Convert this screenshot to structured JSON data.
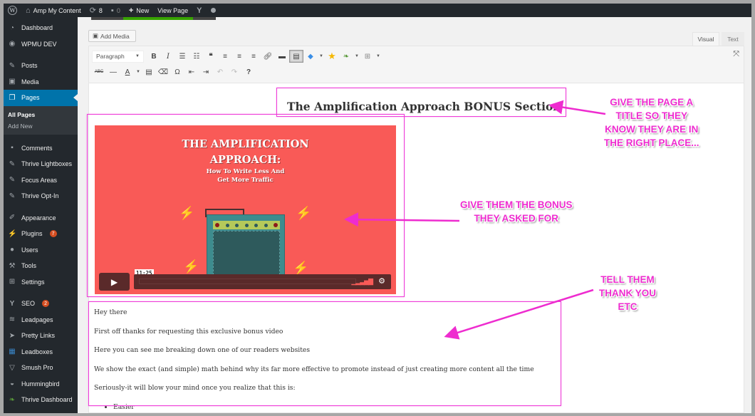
{
  "admin_bar": {
    "site_name": "Amp My Content",
    "updates_count": "8",
    "comments_count": "0",
    "new_label": "New",
    "view_page_label": "View Page",
    "progress": 0.75
  },
  "sidebar": {
    "items": [
      {
        "label": "Dashboard",
        "icon": "dashboard-icon"
      },
      {
        "label": "WPMU DEV",
        "icon": "wpmudev-icon"
      },
      {
        "label": "Posts",
        "icon": "pin-icon"
      },
      {
        "label": "Media",
        "icon": "media-icon"
      },
      {
        "label": "Pages",
        "icon": "pages-icon",
        "active": true
      },
      {
        "label": "Comments",
        "icon": "comment-icon"
      },
      {
        "label": "Thrive Lightboxes",
        "icon": "pin-icon"
      },
      {
        "label": "Focus Areas",
        "icon": "pin-icon"
      },
      {
        "label": "Thrive Opt-In",
        "icon": "pin-icon"
      },
      {
        "label": "Appearance",
        "icon": "brush-icon"
      },
      {
        "label": "Plugins",
        "icon": "plugin-icon",
        "badge": "7"
      },
      {
        "label": "Users",
        "icon": "user-icon"
      },
      {
        "label": "Tools",
        "icon": "wrench-icon"
      },
      {
        "label": "Settings",
        "icon": "settings-icon"
      },
      {
        "label": "SEO",
        "icon": "yoast-icon",
        "badge": "2"
      },
      {
        "label": "Leadpages",
        "icon": "layers-icon"
      },
      {
        "label": "Pretty Links",
        "icon": "star-arrow-icon"
      },
      {
        "label": "Leadboxes",
        "icon": "leadbox-icon"
      },
      {
        "label": "Smush Pro",
        "icon": "smush-icon"
      },
      {
        "label": "Hummingbird",
        "icon": "hummingbird-icon"
      },
      {
        "label": "Thrive Dashboard",
        "icon": "leaf-icon"
      }
    ],
    "pages_submenu": [
      "All Pages",
      "Add New"
    ]
  },
  "editor": {
    "add_media_label": "Add Media",
    "tabs": {
      "visual": "Visual",
      "text": "Text"
    },
    "format_select": "Paragraph",
    "page_title": "The Amplification Approach BONUS Section",
    "video": {
      "title_line1": "THE AMPLIFICATION",
      "title_line2": "APPROACH:",
      "subtitle_line1": "How To Write Less And",
      "subtitle_line2": "Get More Traffic",
      "timecode": "11:25",
      "background_color": "#f95a57"
    },
    "paragraphs": [
      "Hey there",
      "First off thanks for requesting this exclusive bonus video",
      "Here you can see me breaking down one of our readers websites",
      "We show the exact (and simple) math behind why its far more effective to promote instead of just creating more content all the time",
      "Seriously-it will blow your mind once you realize that this is:"
    ],
    "list_items": [
      "Easier"
    ]
  },
  "annotations": {
    "title_note": [
      "GIVE THE PAGE A",
      "TITLE SO THEY",
      "KNOW THEY ARE IN",
      "THE RIGHT PLACE..."
    ],
    "video_note": [
      "GIVE THEM THE BONUS",
      "THEY ASKED FOR"
    ],
    "text_note": [
      "TELL THEM",
      "THANK YOU",
      "ETC"
    ],
    "color": "#ee2ccf"
  }
}
